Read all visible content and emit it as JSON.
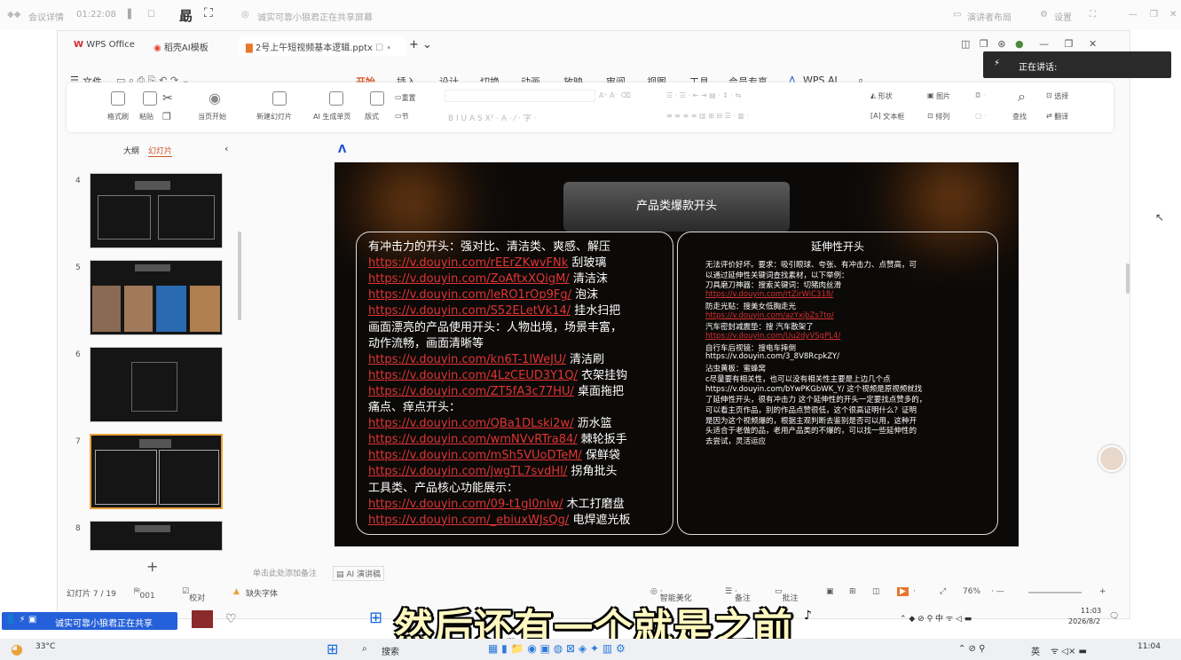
{
  "meeting": {
    "meeting_info": "会议详情",
    "duration": "01:22:08",
    "sharing_status": "诚实可靠小狼君正在共享屏幕",
    "presenter_layout": "演讲者布局",
    "settings": "设置"
  },
  "window_tabs": [
    {
      "label": "WPS Office"
    },
    {
      "label": "稻壳AI模板"
    },
    {
      "label": "2号上午短视频基本逻辑.pptx"
    }
  ],
  "menu": {
    "file": "文件",
    "items": [
      "开始",
      "插入",
      "设计",
      "切换",
      "动画",
      "放映",
      "审阅",
      "视图",
      "工具",
      "会员专享",
      "WPS AI"
    ],
    "active": "开始"
  },
  "ribbon": {
    "format_painter": "格式刷",
    "paste": "粘贴",
    "from_current": "当页开始",
    "new_slide": "新建幻灯片",
    "ai_page": "AI 生成单页",
    "layout": "版式",
    "reset": "重置",
    "section": "节",
    "shape": "形状",
    "picture": "图片",
    "textbox": "文本框",
    "arrange": "排列",
    "find": "查找",
    "select": "选择",
    "translate": "翻译"
  },
  "panel": {
    "outline_tab": "大纲",
    "slides_tab": "幻灯片",
    "slide_numbers": [
      "4",
      "5",
      "6",
      "7",
      "8"
    ],
    "selected": "7"
  },
  "slide": {
    "header": "产品类爆款开头",
    "left_lines": [
      {
        "t": "有冲击力的开头：强对比、清洁类、爽感、解压"
      },
      {
        "u": "https://v.douyin.com/rEErZKwvFNk",
        "t": " 刮玻璃"
      },
      {
        "u": "https://v.douyin.com/ZoAftxXQigM/",
        "t": " 清洁沫"
      },
      {
        "u": "https://v.douyin.com/leRO1rOp9Fg/",
        "t": " 泡沫"
      },
      {
        "u": "https://v.douyin.com/S52ELetVk14/",
        "t": " 挂水扫把"
      },
      {
        "t": "画面漂亮的产品使用开头：人物出境，场景丰富，"
      },
      {
        "t": "动作流畅，画面清晰等"
      },
      {
        "u": "https://v.douyin.com/kn6T-1lWeJU/",
        "t": " 清洁刷"
      },
      {
        "u": "https://v.douyin.com/4LzCEUD3Y1Q/",
        "t": " 衣架挂钩"
      },
      {
        "u": "https://v.douyin.com/ZT5fA3c77HU/",
        "t": " 桌面拖把"
      },
      {
        "t": "痛点、痒点开头："
      },
      {
        "u": "https://v.douyin.com/QBa1DLski2w/",
        "t": " 沥水篮"
      },
      {
        "u": "https://v.douyin.com/wmNVvRTra84/",
        "t": " 棘轮扳手"
      },
      {
        "u": "https://v.douyin.com/mSh5VUoDTeM/",
        "t": " 保鲜袋"
      },
      {
        "u": "https://v.douyin.com/jwgTL7svdHI/",
        "t": " 拐角批头"
      },
      {
        "t": "工具类、产品核心功能展示："
      },
      {
        "u": "https://v.douyin.com/09-t1gI0nlw/",
        "t": " 木工打磨盘"
      },
      {
        "u": "https://v.douyin.com/_ebiuxWJsQg/",
        "t": " 电焊遮光板"
      }
    ],
    "right_title": "延伸性开头",
    "right_lines": [
      {
        "t": "无法评价好坏。要求：吸引眼球、夸张、有冲击力、点赞高，可"
      },
      {
        "t": "以通过延伸性关键词查找素材，以下举例："
      },
      {
        "t": "刀具磨刀神器：搜索关键词：切猪肉丝滑"
      },
      {
        "u": "https://v.douyin.com/rtZirWiC318/"
      },
      {
        "t": "防走光贴：搜美女低胸走光"
      },
      {
        "u": "https://v.douyin.com/azYxjbZs7to/"
      },
      {
        "t": "汽车密封减震垫：搜 汽车散架了"
      },
      {
        "u": "https://v.douyin.com/Uu2dyVSgPL4/"
      },
      {
        "t": "自行车后视镜：搜电车摔倒"
      },
      {
        "t": "https://v.douyin.com/3_8V8RcpkZY/"
      },
      {
        "t": "沾虫黄板：蜜蜂窝"
      },
      {
        "t": "c尽量要有相关性，也可以没有相关性主要是上边几个点"
      },
      {
        "t": " https://v.douyin.com/bYwPKGbWK_Y/  这个视频是原视频就找"
      },
      {
        "t": "了延伸性开头，很有冲击力 这个延伸性的开头一定要找点赞多的，"
      },
      {
        "t": "可以看主页作品，别的作品点赞很低，这个很高证明什么？证明"
      },
      {
        "t": "是因为这个视频爆的，根据主观判断去鉴别是否可以用，这种开"
      },
      {
        "t": "头适合于老做的品，老用产品类的不爆的，可以找一些延伸性的"
      },
      {
        "t": "去尝试，灵活运应"
      }
    ]
  },
  "notes_placeholder": "单击此处添加备注",
  "ai_speech": "AI 演讲稿",
  "status": {
    "slide_count": "幻灯片 7 / 19",
    "theme": "001",
    "proof": "校对",
    "missing_font": "缺失字体",
    "beautify": "智能美化",
    "notes": "备注",
    "comments": "批注",
    "zoom": "76%"
  },
  "speaking": {
    "label": "正在讲话:"
  },
  "share_bar": {
    "text": "诚实可靠小狼君正在共享"
  },
  "caption": "然后还有一个就是之前",
  "inner_clock": {
    "time": "11:03",
    "date": "2026/8/2"
  },
  "outer_taskbar": {
    "temp": "33°C",
    "search": "搜索",
    "time": "11:04",
    "lang": "英",
    "ime": "中"
  }
}
